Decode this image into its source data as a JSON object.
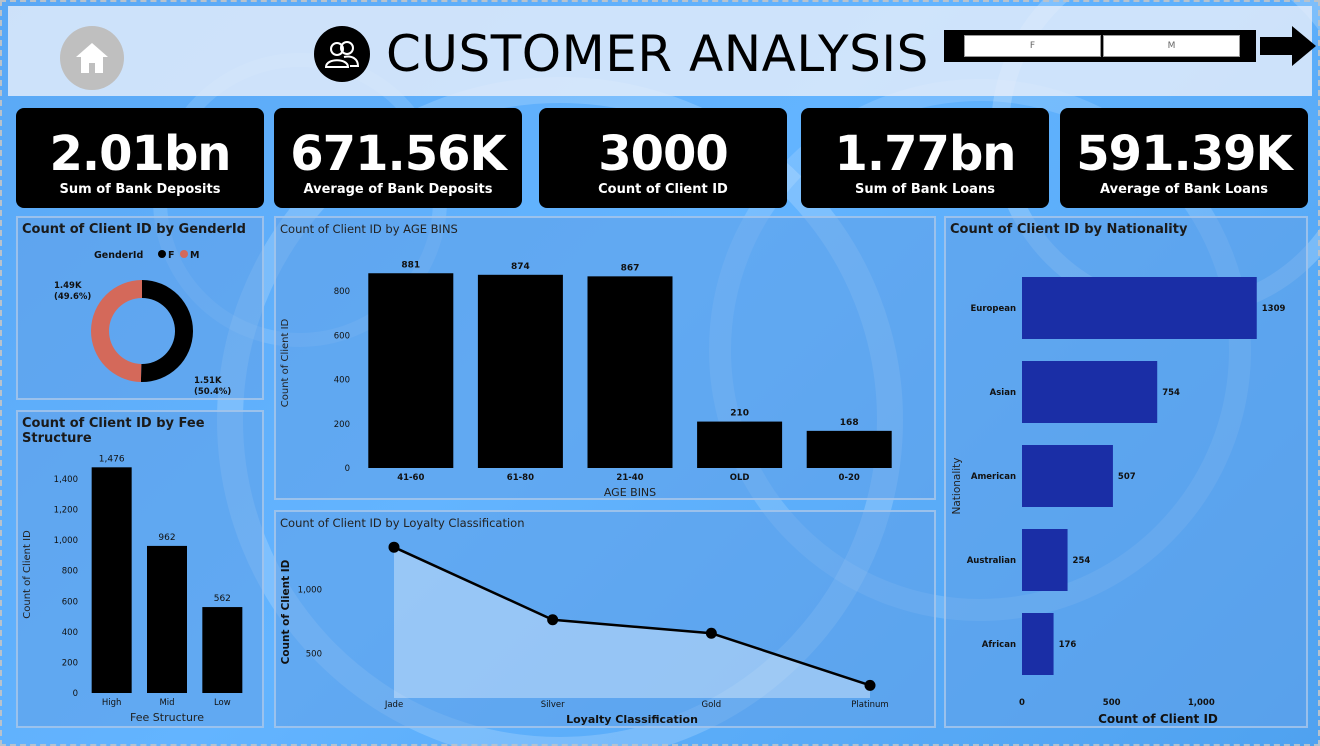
{
  "header": {
    "title": "CUSTOMER ANALYSIS",
    "home_icon": "home-icon",
    "title_icon": "users-icon",
    "slicer": [
      "F",
      "M"
    ],
    "arrow_icon": "arrow-right-icon"
  },
  "kpis": [
    {
      "value": "2.01bn",
      "label": "Sum of Bank Deposits"
    },
    {
      "value": "671.56K",
      "label": "Average of Bank Deposits"
    },
    {
      "value": "3000",
      "label": "Count of Client ID"
    },
    {
      "value": "1.77bn",
      "label": "Sum of Bank Loans"
    },
    {
      "value": "591.39K",
      "label": "Average of Bank Loans"
    }
  ],
  "chart_data": [
    {
      "id": "gender",
      "type": "pie",
      "title": "Count of Client ID by GenderId",
      "legend_title": "GenderId",
      "categories": [
        "F",
        "M"
      ],
      "values": [
        1510,
        1490
      ],
      "data_labels": [
        "1.51K\n(50.4%)",
        "1.49K\n(49.6%)"
      ],
      "colors": [
        "#000000",
        "#d4695a"
      ],
      "legend_position": "top-left"
    },
    {
      "id": "age",
      "type": "bar",
      "title": "Count of Client ID by AGE BINS",
      "categories": [
        "41-60",
        "61-80",
        "21-40",
        "OLD",
        "0-20"
      ],
      "values": [
        881,
        874,
        867,
        210,
        168
      ],
      "xlabel": "AGE BINS",
      "ylabel": "Count of Client ID",
      "ylim": [
        0,
        950
      ],
      "yticks": [
        0,
        200,
        400,
        600,
        800
      ]
    },
    {
      "id": "fee",
      "type": "bar",
      "title": "Count of Client ID by Fee Structure",
      "categories": [
        "High",
        "Mid",
        "Low"
      ],
      "values": [
        1476,
        962,
        562
      ],
      "xlabel": "Fee Structure",
      "ylabel": "Count of Client ID",
      "ylim": [
        0,
        1550
      ],
      "yticks": [
        0,
        200,
        400,
        600,
        800,
        1000,
        1200,
        1400
      ],
      "ytick_labels": [
        "0",
        "200",
        "400",
        "600",
        "800",
        "1,000",
        "1,200",
        "1,400"
      ]
    },
    {
      "id": "loyalty",
      "type": "line",
      "title": "Count of Client ID by Loyalty Classification",
      "categories": [
        "Jade",
        "Silver",
        "Gold",
        "Platinum"
      ],
      "values": [
        1331,
        763,
        657,
        249
      ],
      "xlabel": "Loyalty Classification",
      "ylabel": "Count of Client ID",
      "ylim": [
        150,
        1450
      ],
      "yticks": [
        500,
        1000
      ],
      "ytick_labels": [
        "500",
        "1,000"
      ]
    },
    {
      "id": "nationality",
      "type": "bar",
      "orientation": "horizontal",
      "title": "Count of Client ID by Nationality",
      "categories": [
        "European",
        "Asian",
        "American",
        "Australian",
        "African"
      ],
      "values": [
        1309,
        754,
        507,
        254,
        176
      ],
      "xlabel": "Count of Client ID",
      "ylabel": "Nationality",
      "xlim": [
        0,
        1500
      ],
      "xticks": [
        0,
        500,
        1000
      ],
      "xtick_labels": [
        "0",
        "500",
        "1,000"
      ],
      "color": "#1a2ea6"
    }
  ]
}
